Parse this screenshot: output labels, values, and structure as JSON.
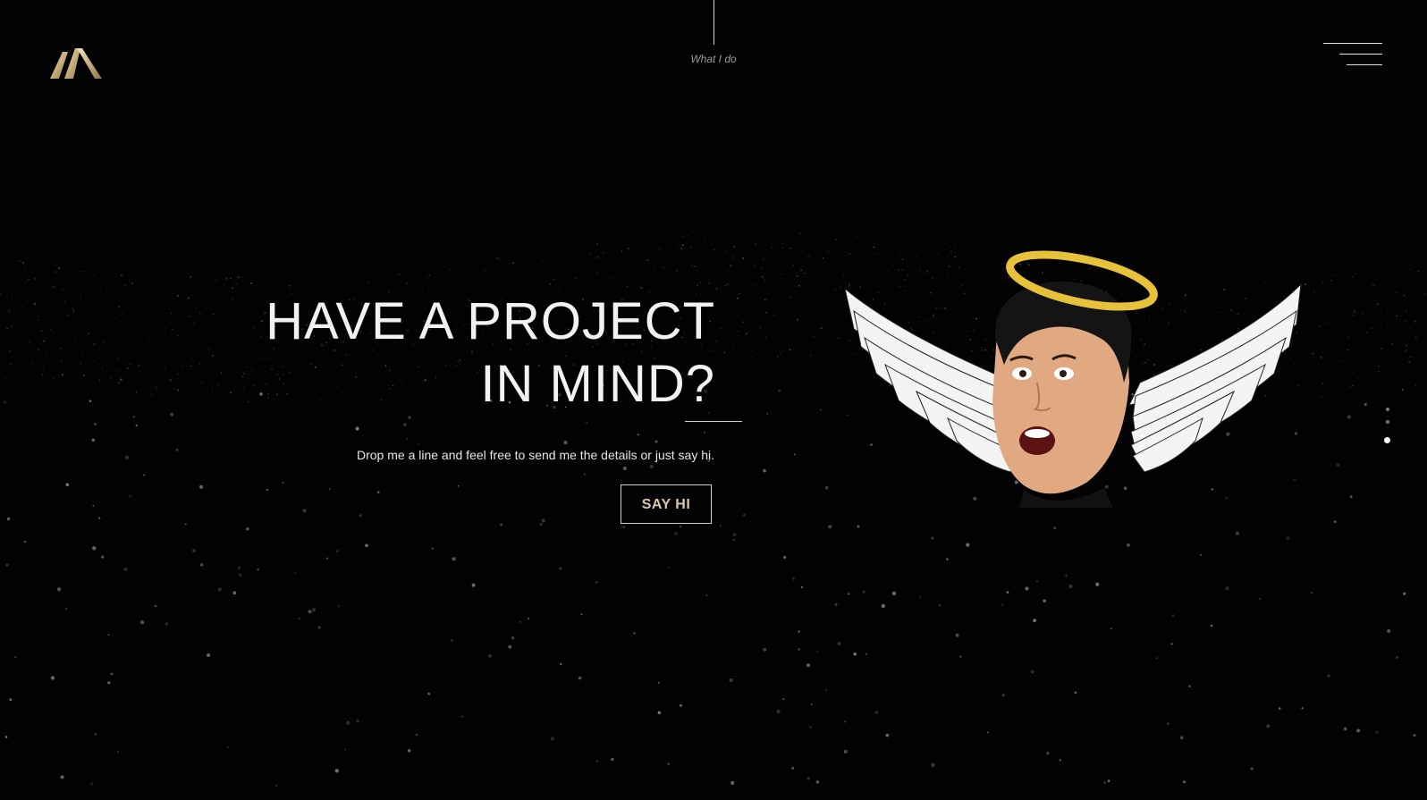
{
  "header": {
    "logo_name": "m-logo",
    "nav_label": "What I do",
    "menu_icon": "hamburger-menu-icon"
  },
  "hero": {
    "headline_line1": "HAVE A PROJECT",
    "headline_line2": "IN MIND?",
    "subtitle": "Drop me a line and feel free to send me the details or just say hi.",
    "cta_label": "SAY HI"
  },
  "illustration": {
    "name": "angel-face-with-wings-and-halo"
  },
  "pager": {
    "count": 3,
    "active_index": 2
  },
  "colors": {
    "background": "#020202",
    "accent_gold": "#d9c7a8",
    "halo_gold": "#e8c13a",
    "text": "#f2f2f2"
  }
}
